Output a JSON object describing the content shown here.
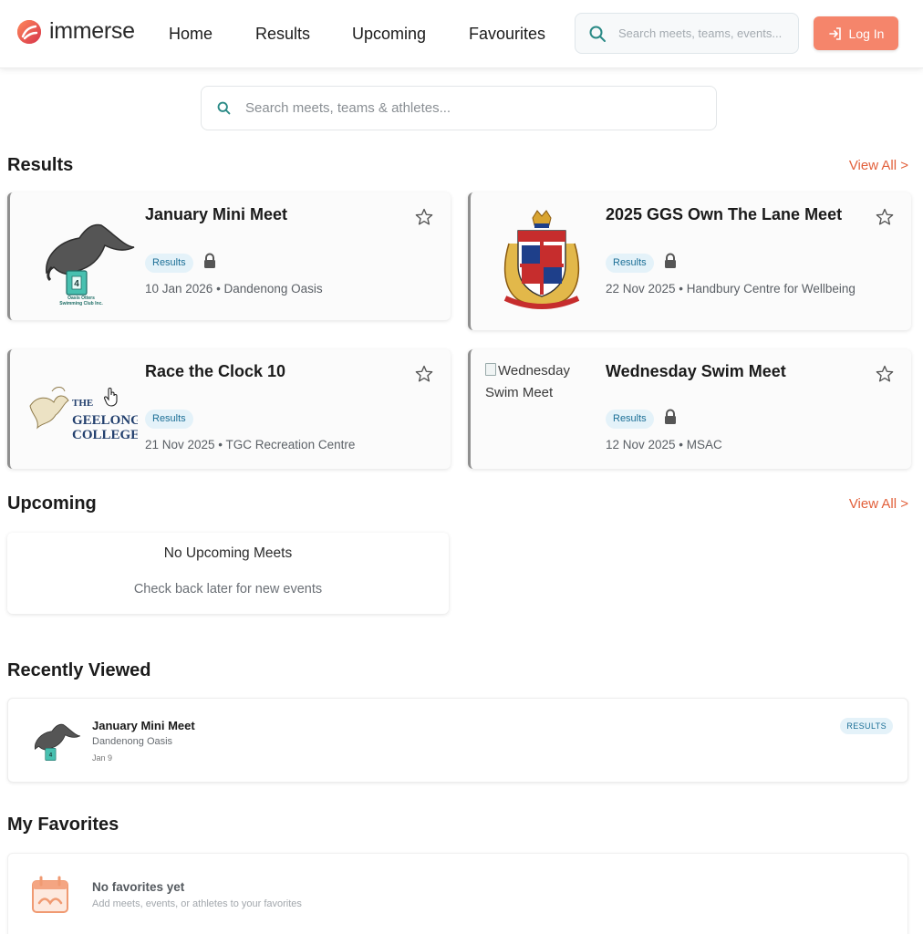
{
  "header": {
    "brand": "immerse",
    "nav": [
      "Home",
      "Results",
      "Upcoming",
      "Favourites"
    ],
    "search_placeholder": "Search meets, teams, events...",
    "login_label": "Log In"
  },
  "main_search": {
    "placeholder": "Search meets, teams & athletes..."
  },
  "results": {
    "title": "Results",
    "view_all": "View All >",
    "cards": [
      {
        "title": "January Mini Meet",
        "badge": "Results",
        "locked": true,
        "meta": "10 Jan 2026 • Dandenong Oasis",
        "logo_caption": "Oasis Otters Swimming Club Inc."
      },
      {
        "title": "2025 GGS Own The Lane Meet",
        "badge": "Results",
        "locked": true,
        "meta": "22 Nov 2025 • Handbury Centre for Wellbeing"
      },
      {
        "title": "Race the Clock 10",
        "badge": "Results",
        "locked": false,
        "meta": "21 Nov 2025 • TGC Recreation Centre",
        "logo_text": [
          "THE",
          "GEELONG",
          "COLLEGE"
        ]
      },
      {
        "title": "Wednesday Swim Meet",
        "badge": "Results",
        "locked": true,
        "meta": "12 Nov 2025 • MSAC",
        "logo_alt": "Wednesday Swim Meet"
      }
    ]
  },
  "upcoming": {
    "title": "Upcoming",
    "view_all": "View All >",
    "empty_title": "No Upcoming Meets",
    "empty_sub": "Check back later for new events"
  },
  "recent": {
    "title": "Recently Viewed",
    "item": {
      "title": "January Mini Meet",
      "venue": "Dandenong Oasis",
      "date": "Jan 9",
      "badge": "RESULTS"
    }
  },
  "favorites": {
    "title": "My Favorites",
    "empty_title": "No favorites yet",
    "empty_sub": "Add meets, events, or athletes to your favorites"
  },
  "colors": {
    "accent": "#e2603b",
    "login": "#f5856b",
    "badge_bg": "#e4f2f9",
    "badge_text": "#1c6f96",
    "teal": "#2a8a86"
  }
}
